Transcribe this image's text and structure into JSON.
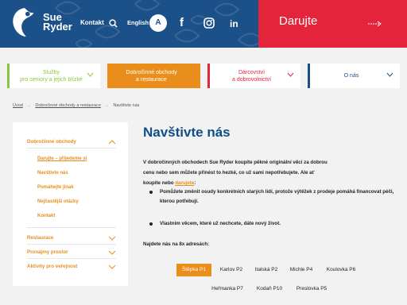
{
  "header": {
    "logo_line1": "Sue",
    "logo_line2": "Ryder",
    "contact": "Kontakt",
    "language": "English",
    "access_label": "A",
    "fb": "f",
    "in": "in"
  },
  "donate": {
    "label": "Darujte"
  },
  "menu": [
    {
      "label_line1": "Služby",
      "label_line2": "pro seniory a jejich blízké",
      "color": "#8cc63f",
      "active": false
    },
    {
      "label_line1": "Dobročinné obchody",
      "label_line2": "a restaurace",
      "color": "#e98e1b",
      "active": true
    },
    {
      "label_line1": "Dárcovství",
      "label_line2": "a dobrovolnictví",
      "color": "#e3243b",
      "active": false
    },
    {
      "label_line1": "O nás",
      "label_line2": "",
      "color": "#1b5188",
      "active": false
    }
  ],
  "breadcrumb": {
    "home": "Úvod",
    "section": "Dobročinné obchody a restaurace",
    "current": "Navštivte nás"
  },
  "sidebar": {
    "section1": "Dobročinné obchody",
    "subitems": [
      "Darujte – přijedeme si",
      "Navštivte nás",
      "Pomáhejte jinak",
      "Nejčastější otázky",
      "Kontakt"
    ],
    "section2": "Restaurace",
    "section3": "Pronájmy prostor",
    "section4": "Aktivity pro veřejnost"
  },
  "main": {
    "title": "Navštivte nás",
    "para_part1": "V dobročinných obchodech Sue Ryder koupíte pěkné originální věci za dobrou cenu nebo sem můžete přinést to hezké, co už sami nepotřebujete. Ale ať koupíte nebo ",
    "para_link": "darujete",
    "para_part2": ":",
    "bullet1": "Pomůžete změnit osudy konkrétních starých lidí, protože výtěžek z prodeje pomáhá financovat péči, kterou potřebují.",
    "bullet2": "Vlastním věcem, které už nechcete, dáte nový život.",
    "find_text": "Najdete nás na 8x adresách:"
  },
  "stores_row1": [
    "Štěpka P1",
    "Karlov P2",
    "Italská P2",
    "Michle P4",
    "Koulovka P6"
  ],
  "stores_row2": [
    "Heřmanka P7",
    "Kodaň P10",
    "Preslovka P5"
  ],
  "colors": {
    "blue": "#1b5188",
    "red": "#e3243b",
    "orange": "#e98e1b",
    "green": "#8cc63f"
  }
}
